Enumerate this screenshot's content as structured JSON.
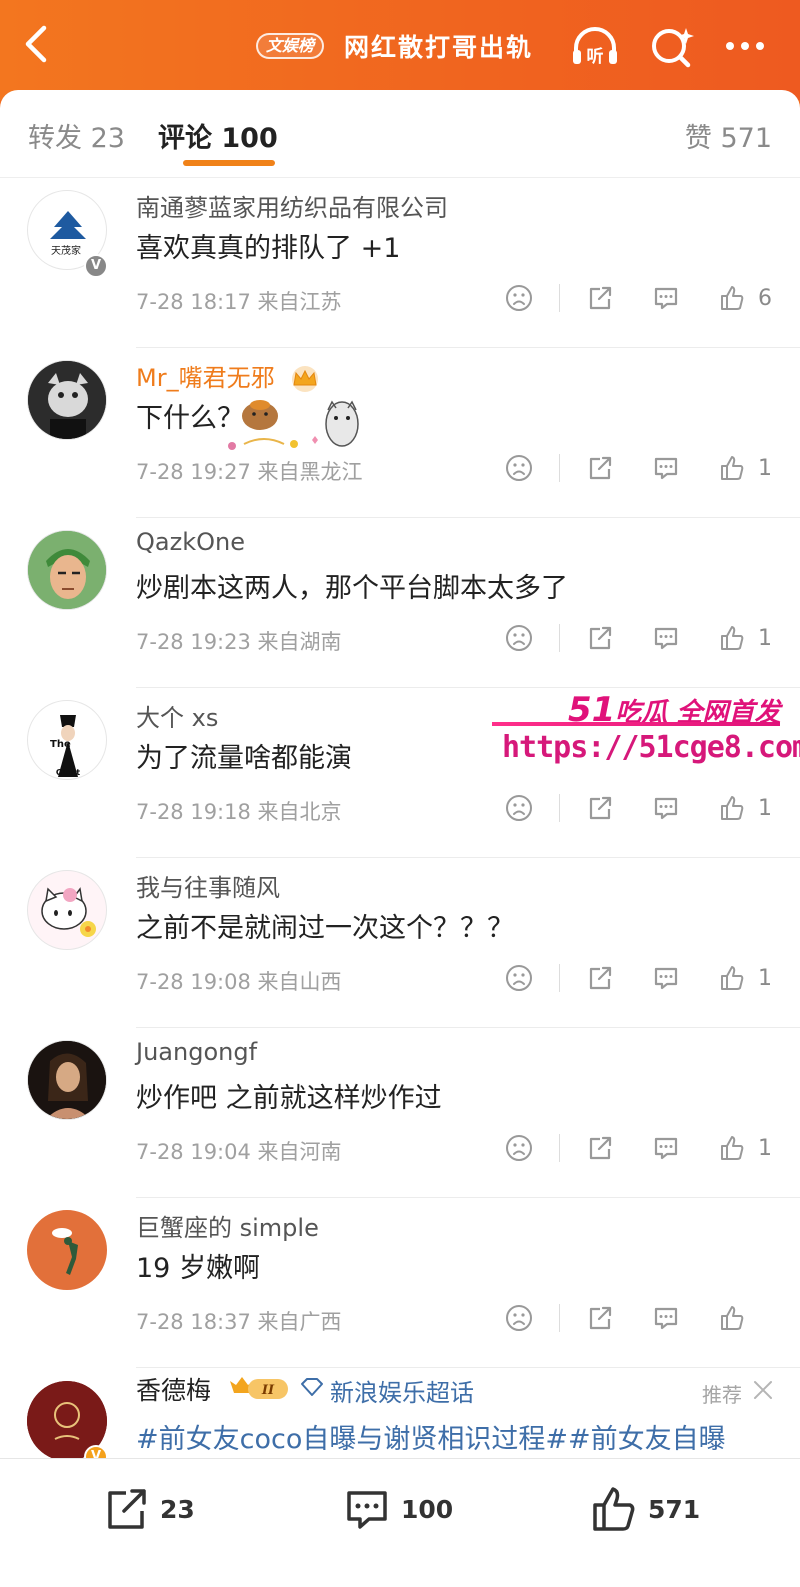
{
  "header": {
    "tag": "文娱榜",
    "title": "网红散打哥出轨",
    "listen_label": "听"
  },
  "tabs": {
    "repost": "转发 23",
    "comment": "评论 100",
    "like": "赞 571"
  },
  "comments": [
    {
      "name": "南通蓼蓝家用纺织品有限公司",
      "text": "喜欢真真的排队了 +1",
      "meta": "7-28 18:17 来自江苏",
      "likes": "6"
    },
    {
      "name": "Mr_嘴君无邪",
      "text": "下什么？",
      "meta": "7-28 19:27 来自黑龙江",
      "likes": "1"
    },
    {
      "name": "QazkOne",
      "text": "炒剧本这两人，那个平台脚本太多了",
      "meta": "7-28 19:23 来自湖南",
      "likes": "1"
    },
    {
      "name": "大个 xs",
      "text": "为了流量啥都能演",
      "meta": "7-28 19:18 来自北京",
      "likes": "1"
    },
    {
      "name": "我与往事随风",
      "text": "之前不是就闹过一次这个？？？",
      "meta": "7-28 19:08 来自山西",
      "likes": "1"
    },
    {
      "name": "Juangongf",
      "text": "炒作吧 之前就这样炒作过",
      "meta": "7-28 19:04 来自河南",
      "likes": "1"
    },
    {
      "name": "巨蟹座的 simple",
      "text": "19 岁嫩啊",
      "meta": "7-28 18:37 来自广西",
      "likes": ""
    }
  ],
  "avatar_texts": {
    "logo_caption": "天茂家",
    "giant_top": "The",
    "giant_bottom": "Giant"
  },
  "watermark": {
    "line1_num": "51",
    "line1_text": "吃瓜 全网首发",
    "url": "https://51cge8.com"
  },
  "last_item": {
    "name": "香德梅",
    "badge": "II",
    "topic": "新浪娱乐超话",
    "recommend": "推荐",
    "hashtag": "#前女友coco自曝与谢贤相识过程##前女友自曝"
  },
  "bottom_bar": {
    "repost": "23",
    "comment": "100",
    "like": "571"
  },
  "colors": {
    "header": "#f26b1d",
    "accent": "#f08219",
    "vip_name": "#ef7c1c",
    "link": "#3e6ea8"
  }
}
